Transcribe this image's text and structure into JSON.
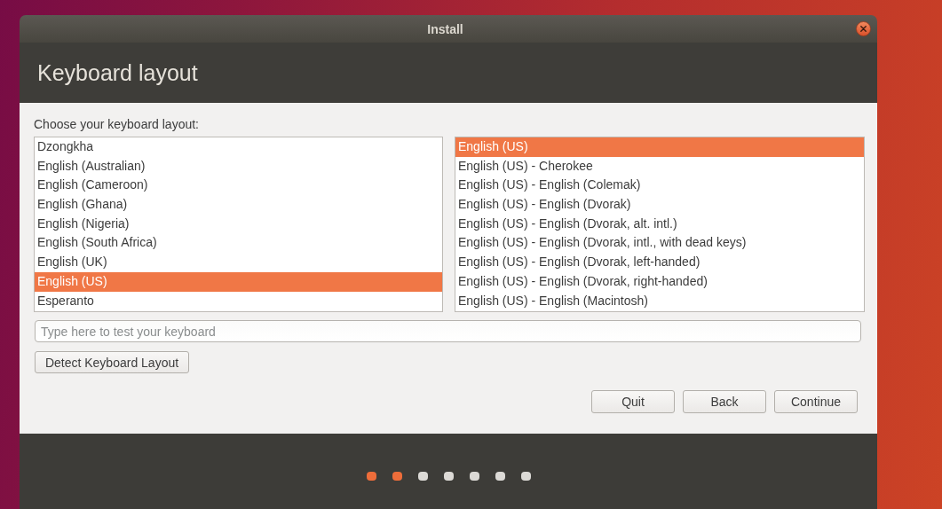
{
  "window": {
    "title": "Install"
  },
  "header": {
    "title": "Keyboard layout"
  },
  "layout_prompt": "Choose your keyboard layout:",
  "layouts": [
    {
      "label": "Dzongkha",
      "selected": false
    },
    {
      "label": "English (Australian)",
      "selected": false
    },
    {
      "label": "English (Cameroon)",
      "selected": false
    },
    {
      "label": "English (Ghana)",
      "selected": false
    },
    {
      "label": "English (Nigeria)",
      "selected": false
    },
    {
      "label": "English (South Africa)",
      "selected": false
    },
    {
      "label": "English (UK)",
      "selected": false
    },
    {
      "label": "English (US)",
      "selected": true
    },
    {
      "label": "Esperanto",
      "selected": false
    }
  ],
  "variants": [
    {
      "label": "English (US)",
      "selected": true
    },
    {
      "label": "English (US) - Cherokee",
      "selected": false
    },
    {
      "label": "English (US) - English (Colemak)",
      "selected": false
    },
    {
      "label": "English (US) - English (Dvorak)",
      "selected": false
    },
    {
      "label": "English (US) - English (Dvorak, alt. intl.)",
      "selected": false
    },
    {
      "label": "English (US) - English (Dvorak, intl., with dead keys)",
      "selected": false
    },
    {
      "label": "English (US) - English (Dvorak, left-handed)",
      "selected": false
    },
    {
      "label": "English (US) - English (Dvorak, right-handed)",
      "selected": false
    },
    {
      "label": "English (US) - English (Macintosh)",
      "selected": false
    }
  ],
  "test_field": {
    "placeholder": "Type here to test your keyboard"
  },
  "detect_button": "Detect Keyboard Layout",
  "buttons": [
    "Quit",
    "Back",
    "Continue"
  ],
  "progress": [
    {
      "done": true
    },
    {
      "done": true
    },
    {
      "done": false
    },
    {
      "done": false
    },
    {
      "done": false
    },
    {
      "done": false
    },
    {
      "done": false
    }
  ]
}
